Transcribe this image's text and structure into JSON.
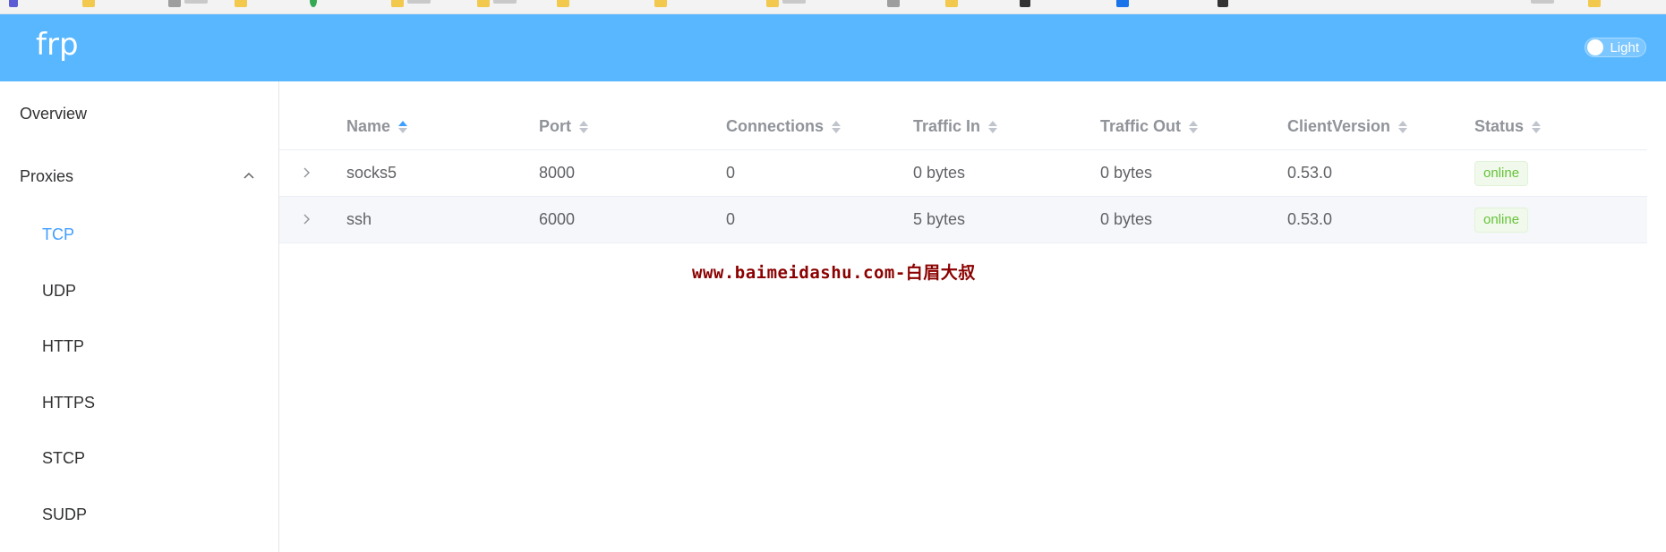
{
  "app": {
    "brand": "frp",
    "theme_toggle_label": "Light"
  },
  "sidebar": {
    "items": [
      {
        "label": "Overview"
      },
      {
        "label": "Proxies"
      }
    ],
    "proxies_submenu": [
      {
        "label": "TCP",
        "active": true
      },
      {
        "label": "UDP"
      },
      {
        "label": "HTTP"
      },
      {
        "label": "HTTPS"
      },
      {
        "label": "STCP"
      },
      {
        "label": "SUDP"
      }
    ]
  },
  "table": {
    "columns": [
      "Name",
      "Port",
      "Connections",
      "Traffic In",
      "Traffic Out",
      "ClientVersion",
      "Status"
    ],
    "sorted_column": "Name",
    "rows": [
      {
        "name": "socks5",
        "port": "8000",
        "connections": "0",
        "traffic_in": "0 bytes",
        "traffic_out": "0 bytes",
        "client_version": "0.53.0",
        "status": "online"
      },
      {
        "name": "ssh",
        "port": "6000",
        "connections": "0",
        "traffic_in": "5 bytes",
        "traffic_out": "0 bytes",
        "client_version": "0.53.0",
        "status": "online"
      }
    ]
  },
  "watermark": "www.baimeidashu.com-白眉大叔",
  "colors": {
    "header": "#58b7ff",
    "active": "#409eff",
    "online_tag_text": "#67c23a",
    "watermark": "#8b0000"
  }
}
